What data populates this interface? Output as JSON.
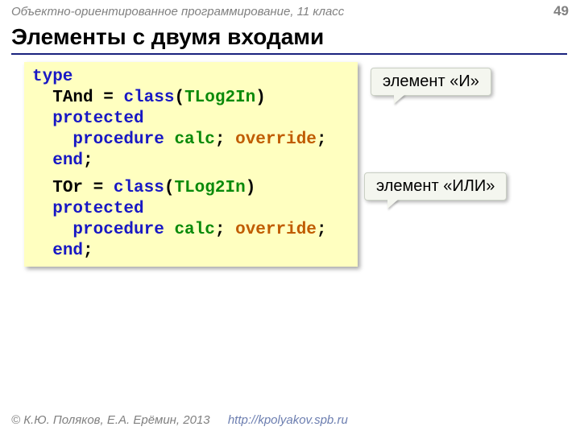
{
  "course": "Объектно-ориентированное программирование, 11 класс",
  "page": "49",
  "title": "Элементы с двумя входами",
  "code": {
    "kw_type": "type",
    "tand_def_a": "TAnd = ",
    "tand_def_b": "class",
    "tand_def_c": "(",
    "tand_cls": "TLog2In",
    "tand_def_d": ")",
    "protected": "protected",
    "proc_a": "procedure",
    "calc": "calc",
    "semi": ";",
    "override": "override",
    "end": "end",
    "tor_def_a": "TOr = ",
    "tor_def_b": "class",
    "tor_def_c": "(",
    "tor_cls": "TLog2In",
    "tor_def_d": ")"
  },
  "callout_and": "элемент «И»",
  "callout_or": "элемент «ИЛИ»",
  "footer_author": "© К.Ю. Поляков, Е.А. Ерёмин, 2013",
  "footer_url": "http://kpolyakov.spb.ru"
}
